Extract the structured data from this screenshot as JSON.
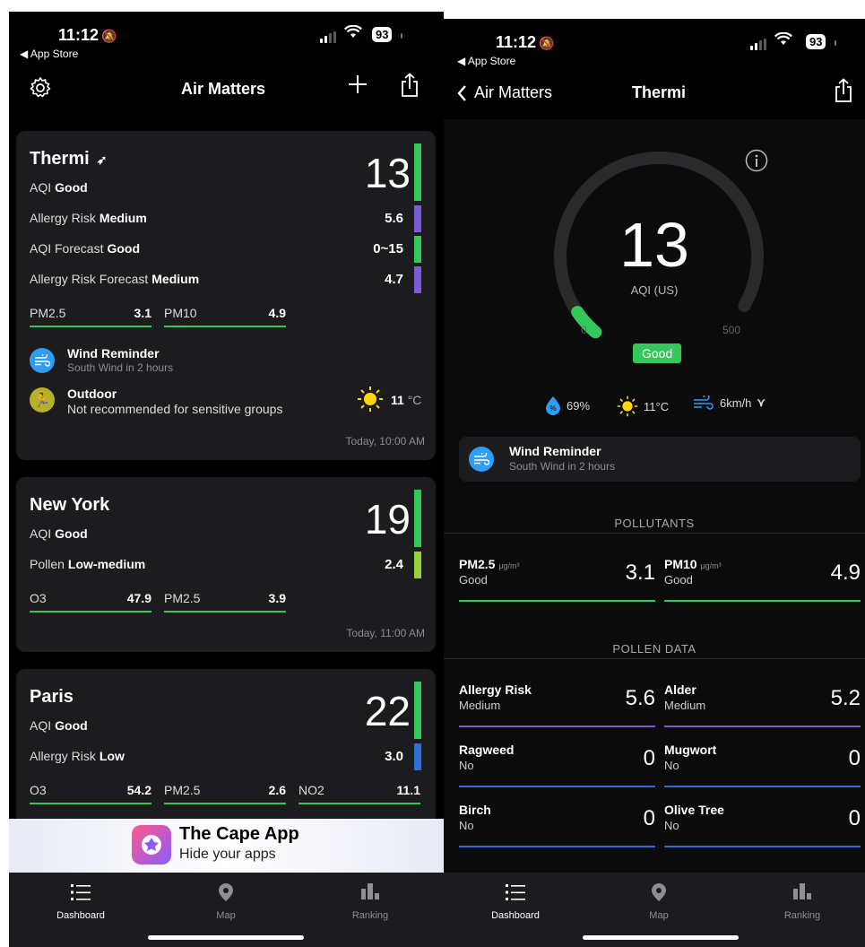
{
  "status": {
    "time": "11:12",
    "back_app": "◀ App Store",
    "battery": "93"
  },
  "dashboard": {
    "title": "Air Matters",
    "cards": [
      {
        "city": "Thermi",
        "aqi_value": "13",
        "aqi_label": "AQI",
        "aqi_status": "Good",
        "rows": [
          {
            "label": "Allergy Risk",
            "status": "Medium",
            "value": "5.6"
          },
          {
            "label": "AQI Forecast",
            "status": "Good",
            "value": "0~15"
          },
          {
            "label": "Allergy Risk Forecast",
            "status": "Medium",
            "value": "4.7"
          }
        ],
        "cells": [
          {
            "name": "PM2.5",
            "value": "3.1"
          },
          {
            "name": "PM10",
            "value": "4.9"
          }
        ],
        "reminder_title": "Wind Reminder",
        "reminder_sub": "South Wind in 2 hours",
        "outdoor_title": "Outdoor",
        "outdoor_sub": "Not recommended for sensitive groups",
        "temp": "11",
        "temp_unit": "°C",
        "updated": "Today, 10:00 AM"
      },
      {
        "city": "New York",
        "aqi_value": "19",
        "aqi_label": "AQI",
        "aqi_status": "Good",
        "rows": [
          {
            "label": "Pollen",
            "status": "Low-medium",
            "value": "2.4"
          }
        ],
        "cells": [
          {
            "name": "O3",
            "value": "47.9"
          },
          {
            "name": "PM2.5",
            "value": "3.9"
          }
        ],
        "updated": "Today, 11:00 AM"
      },
      {
        "city": "Paris",
        "aqi_value": "22",
        "aqi_label": "AQI",
        "aqi_status": "Good",
        "rows": [
          {
            "label": "Allergy Risk",
            "status": "Low",
            "value": "3.0"
          }
        ],
        "cells": [
          {
            "name": "O3",
            "value": "54.2"
          },
          {
            "name": "PM2.5",
            "value": "2.6"
          },
          {
            "name": "NO2",
            "value": "11.1"
          }
        ]
      }
    ],
    "ad": {
      "title": "The Cape App",
      "subtitle": "Hide your apps"
    }
  },
  "tabs": [
    {
      "label": "Dashboard"
    },
    {
      "label": "Map"
    },
    {
      "label": "Ranking"
    }
  ],
  "detail": {
    "back_label": "Air Matters",
    "title": "Thermi",
    "aqi_value": "13",
    "aqi_unit": "AQI (US)",
    "gauge_min": "0",
    "gauge_max": "500",
    "aqi_fraction": 0.026,
    "status": "Good",
    "humidity": "69%",
    "temperature": "11°C",
    "wind": "6km/h",
    "reminder_title": "Wind Reminder",
    "reminder_sub": "South Wind in 2 hours",
    "pollutants_header": "POLLUTANTS",
    "pollutants": [
      {
        "name": "PM2.5",
        "unit": "μg/m³",
        "status": "Good",
        "value": "3.1"
      },
      {
        "name": "PM10",
        "unit": "μg/m³",
        "status": "Good",
        "value": "4.9"
      }
    ],
    "pollen_header": "POLLEN DATA",
    "pollen": [
      {
        "name": "Allergy Risk",
        "status": "Medium",
        "value": "5.6"
      },
      {
        "name": "Alder",
        "status": "Medium",
        "value": "5.2"
      },
      {
        "name": "Ragweed",
        "status": "No",
        "value": "0"
      },
      {
        "name": "Mugwort",
        "status": "No",
        "value": "0"
      },
      {
        "name": "Birch",
        "status": "No",
        "value": "0"
      },
      {
        "name": "Olive Tree",
        "status": "No",
        "value": "0"
      }
    ]
  },
  "colors": {
    "good": "#34c759",
    "medium": "#7d5bd6",
    "low": "#2d6fd4",
    "lowmed": "#9ad13a",
    "accent": "#2f9df4"
  }
}
